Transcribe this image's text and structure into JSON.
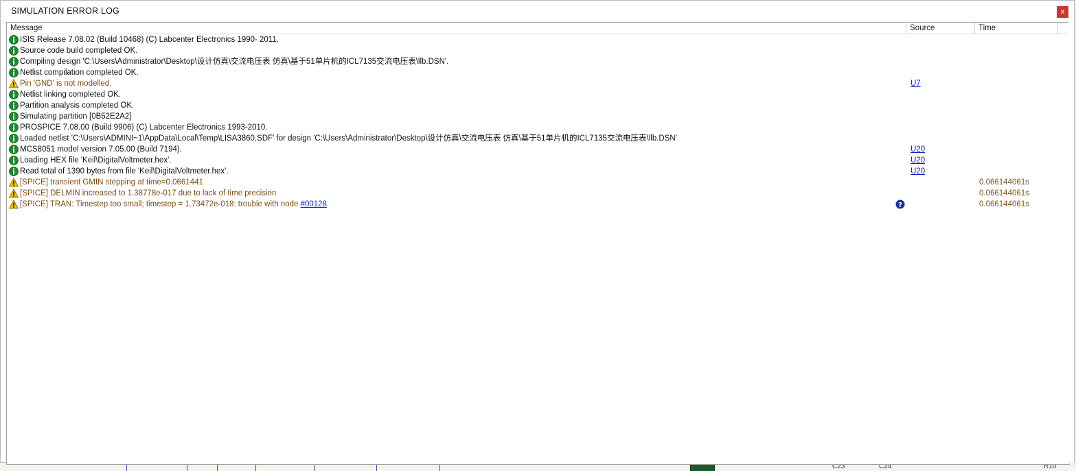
{
  "window": {
    "title": "SIMULATION ERROR LOG",
    "close_label": "x"
  },
  "columns": {
    "message": "Message",
    "source": "Source",
    "time": "Time"
  },
  "rows": [
    {
      "type": "info",
      "message": "ISIS Release 7.08.02 (Build 10468) (C) Labcenter Electronics 1990- 2011.",
      "source": "",
      "time": ""
    },
    {
      "type": "info",
      "message": "Source code build completed OK.",
      "source": "",
      "time": ""
    },
    {
      "type": "info",
      "message": "Compiling design 'C:\\Users\\Administrator\\Desktop\\设计仿真\\交流电压表 仿真\\基于51单片机的ICL7135交流电压表\\llb.DSN'.",
      "source": "",
      "time": ""
    },
    {
      "type": "info",
      "message": "Netlist compilation completed OK.",
      "source": "",
      "time": ""
    },
    {
      "type": "warning",
      "message": "Pin 'GND' is not modelled.",
      "source": "U7",
      "time": ""
    },
    {
      "type": "info",
      "message": "Netlist linking completed OK.",
      "source": "",
      "time": ""
    },
    {
      "type": "info",
      "message": "Partition analysis completed OK.",
      "source": "",
      "time": ""
    },
    {
      "type": "info",
      "message": "Simulating partition [0B52E2A2]",
      "source": "",
      "time": ""
    },
    {
      "type": "info",
      "message": "PROSPICE 7.08.00 (Build 9906) (C) Labcenter Electronics 1993-2010.",
      "source": "",
      "time": ""
    },
    {
      "type": "info",
      "message": "Loaded netlist 'C:\\Users\\ADMINI~1\\AppData\\Local\\Temp\\LISA3860.SDF' for design 'C:\\Users\\Administrator\\Desktop\\设计仿真\\交流电压表 仿真\\基于51单片机的ICL7135交流电压表\\llb.DSN'",
      "source": "",
      "time": ""
    },
    {
      "type": "info",
      "message": "MCS8051 model version 7.05.00 (Build 7194).",
      "source": "U20",
      "time": ""
    },
    {
      "type": "info",
      "message": "Loading HEX file 'Keil\\DigitalVoltmeter.hex'.",
      "source": "U20",
      "time": ""
    },
    {
      "type": "info",
      "message": "Read total of 1390 bytes from file 'Keil\\DigitalVoltmeter.hex'.",
      "source": "U20",
      "time": ""
    },
    {
      "type": "warning",
      "message": "[SPICE] transient GMIN stepping at time=0.0661441",
      "source": "",
      "time": "0.066144061s"
    },
    {
      "type": "warning",
      "message": "[SPICE] DELMIN increased to 1.38778e-017 due to lack of time precision",
      "source": "",
      "time": "0.066144061s"
    },
    {
      "type": "warning",
      "message": "[SPICE] TRAN:  Timestep too small; timestep = 1.73472e-018: trouble with node ",
      "node_link": "#00128",
      "suffix": ".",
      "help": true,
      "source": "",
      "time": "0.066144061s"
    }
  ],
  "background_labels": [
    "C23",
    "C24",
    "R10"
  ],
  "colors": {
    "info_icon": "#1e8a2c",
    "warning_icon": "#e8c200",
    "warning_text": "#7a4b12",
    "link": "#1020c0",
    "close_button": "#c8372d",
    "help_icon": "#1530a8"
  }
}
